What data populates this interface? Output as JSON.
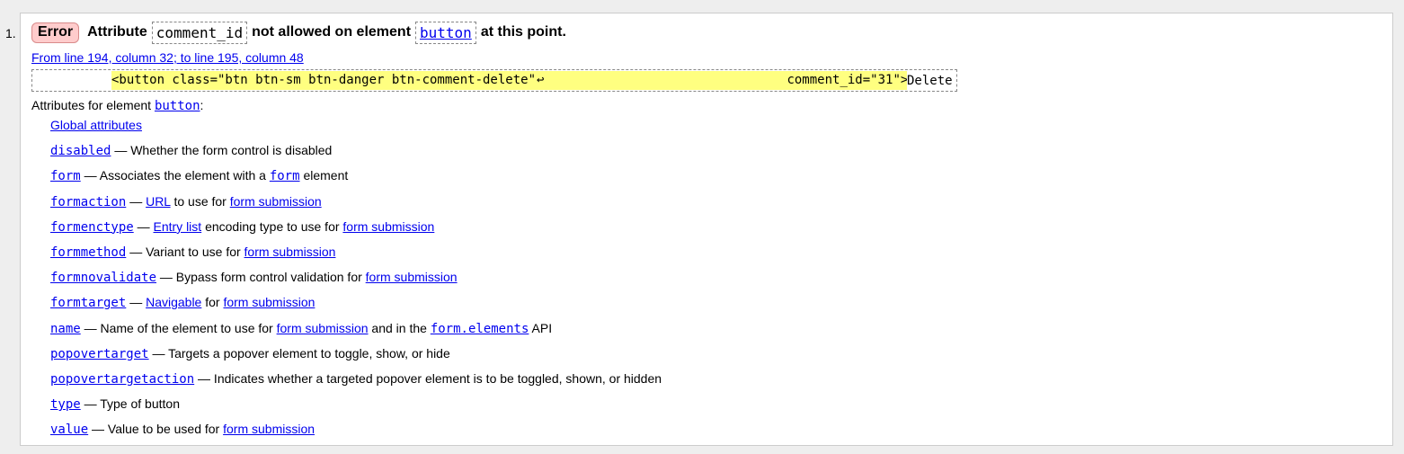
{
  "list_number": "1.",
  "message": {
    "severity": "Error",
    "text_1": "Attribute",
    "attribute": "comment_id",
    "text_2": "not allowed on element",
    "element": "button",
    "text_3": "at this point."
  },
  "location": "From line 194, column 32; to line 195, column 48",
  "source": {
    "highlight_start": "<button class=\"btn btn-sm btn-danger btn-comment-delete\"",
    "line_break_glyph": "↩",
    "highlight_end": "comment_id=\"31\">",
    "tail": "Delete"
  },
  "attributes_header": {
    "prefix": "Attributes for element",
    "element": "button",
    "suffix": ":"
  },
  "global_attributes": "Global attributes",
  "attributes": [
    {
      "name": "disabled",
      "desc": [
        {
          "t": "— Whether the form control is disabled"
        }
      ]
    },
    {
      "name": "form",
      "desc": [
        {
          "t": "— Associates the element with a"
        },
        {
          "t": "form",
          "link": true,
          "mono": true
        },
        {
          "t": "element"
        }
      ]
    },
    {
      "name": "formaction",
      "desc": [
        {
          "t": "—"
        },
        {
          "t": "URL",
          "link": true
        },
        {
          "t": "to use for"
        },
        {
          "t": "form submission",
          "link": true
        }
      ]
    },
    {
      "name": "formenctype",
      "desc": [
        {
          "t": "—"
        },
        {
          "t": "Entry list",
          "link": true
        },
        {
          "t": "encoding type to use for"
        },
        {
          "t": "form submission",
          "link": true
        }
      ]
    },
    {
      "name": "formmethod",
      "desc": [
        {
          "t": "— Variant to use for"
        },
        {
          "t": "form submission",
          "link": true
        }
      ]
    },
    {
      "name": "formnovalidate",
      "desc": [
        {
          "t": "— Bypass form control validation for"
        },
        {
          "t": "form submission",
          "link": true
        }
      ]
    },
    {
      "name": "formtarget",
      "desc": [
        {
          "t": "—"
        },
        {
          "t": "Navigable",
          "link": true
        },
        {
          "t": "for"
        },
        {
          "t": "form submission",
          "link": true
        }
      ]
    },
    {
      "name": "name",
      "desc": [
        {
          "t": "— Name of the element to use for"
        },
        {
          "t": "form submission",
          "link": true
        },
        {
          "t": "and in the"
        },
        {
          "t": "form.elements",
          "link": true,
          "mono": true
        },
        {
          "t": "API"
        }
      ]
    },
    {
      "name": "popovertarget",
      "desc": [
        {
          "t": "— Targets a popover element to toggle, show, or hide"
        }
      ]
    },
    {
      "name": "popovertargetaction",
      "desc": [
        {
          "t": "— Indicates whether a targeted popover element is to be toggled, shown, or hidden"
        }
      ]
    },
    {
      "name": "type",
      "desc": [
        {
          "t": "— Type of button"
        }
      ]
    },
    {
      "name": "value",
      "desc": [
        {
          "t": "— Value to be used for"
        },
        {
          "t": "form submission",
          "link": true
        }
      ]
    }
  ],
  "colors": {
    "error_badge_bg": "#ffcccc",
    "highlight": "#ffff80",
    "link": "#0000ee"
  }
}
